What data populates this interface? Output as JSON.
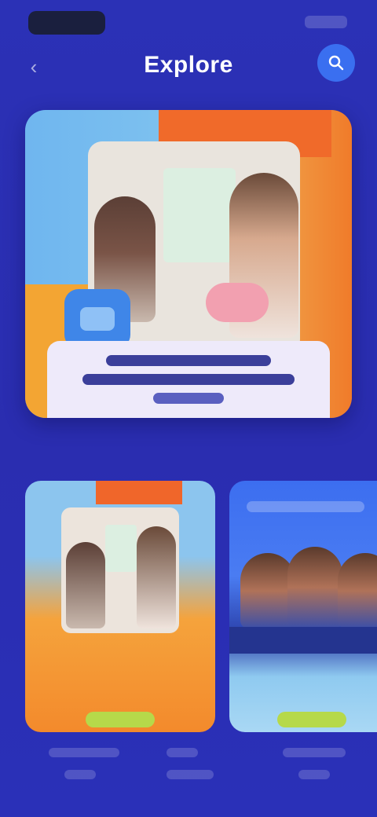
{
  "header": {
    "title": "Explore",
    "back_icon": "chevron-left-icon",
    "action_icon": "search-icon"
  },
  "colors": {
    "background": "#2a2fb2",
    "accent": "#3a6ff0",
    "warm": "#f3a533",
    "pill": "#b6d94a"
  },
  "hero": {
    "image": "hero-illustration"
  },
  "section": {
    "title": "",
    "link": ""
  },
  "cards": [
    {
      "image": "card-illustration-1"
    },
    {
      "image": "card-illustration-2"
    }
  ]
}
